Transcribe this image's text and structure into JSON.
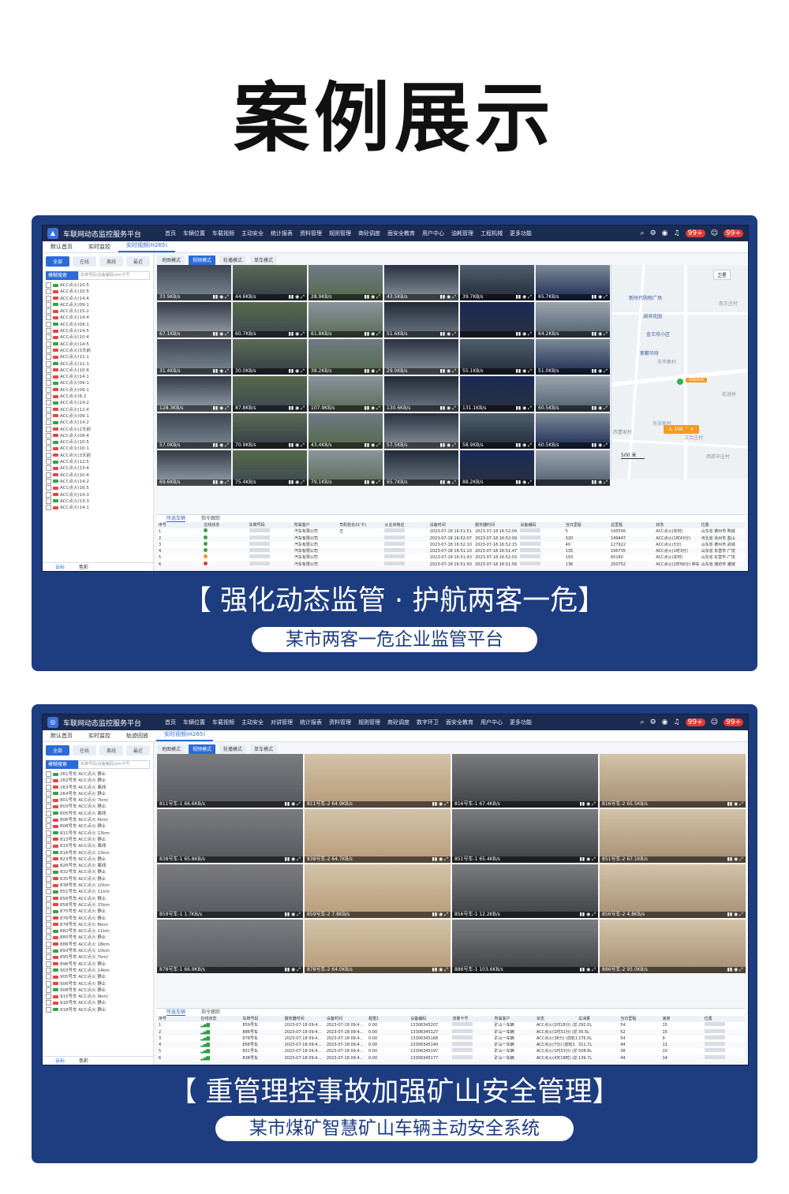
{
  "page": {
    "title": "案例展示"
  },
  "colors": {
    "panel": "#1e3c80",
    "accent": "#2b6bd8",
    "online": "#37a04a",
    "alarm": "#e04848"
  },
  "case1": {
    "caption": "【 强化动态监管 · 护航两客一危】",
    "subtitle": "某市两客一危企业监管平台",
    "app_title": "车联网动态监控服务平台",
    "menu": [
      "首页",
      "车辆位置",
      "车载视频",
      "主动安全",
      "统计报表",
      "资料管理",
      "规则管理",
      "商砼调度",
      "面安全教育",
      "用户中心",
      "油耗管理",
      "工程机械",
      "更多功能"
    ],
    "badges": [
      "99+",
      "99+"
    ],
    "tabs": [
      "默认首页",
      "实时监控",
      "实时视频(H265)"
    ],
    "seg": [
      "全部",
      "在线",
      "离线",
      "最近"
    ],
    "search": {
      "select": "模糊搜索",
      "placeholder": "车牌号码/设备编码/sim卡号"
    },
    "tree": [
      "ACC点火(10:5",
      "ACC点火(10:5",
      "ACC点火(14:4",
      "ACC点火(09:1",
      "ACC点火(15:2",
      "ACC点火(14:4",
      "ACC点火(09:1",
      "ACC点火(14:5",
      "ACC点火(10:4",
      "ACC点火(14:5",
      "ACC点火(3天前",
      "ACC点火(11:1",
      "ACC点火(11:1",
      "ACC点火(10:4",
      "ACC点火(14:1",
      "ACC点火(09:1",
      "ACC点火(09:1",
      "ACC点火(6:2",
      "ACC点火(14:2",
      "ACC点火(12:4",
      "ACC点火(09:1",
      "ACC点火(14:2",
      "ACC点火(2天前",
      "ACC点火(09:4",
      "ACC点火(10:5",
      "ACC点火(10:1",
      "ACC点火(3天前",
      "ACC点火(12:5",
      "ACC点火(13:4",
      "ACC点火(10:4",
      "ACC点火(14:2",
      "ACC点火(16:5",
      "ACC点火(14:3",
      "ACC点火(13:3",
      "ACC点火(14:1"
    ],
    "sidefoot": [
      "云标",
      "色彩"
    ],
    "modes": [
      "地图模式",
      "视频模式",
      "轮播模式",
      "单车模式"
    ],
    "video_rates": [
      "33.9KB/s",
      "44.6KB/s",
      "28.9KB/s",
      "43.5KB/s",
      "39.7KB/s",
      "65.7KB/s",
      "67.1KB/s",
      "60.7KB/s",
      "61.8KB/s",
      "51.6KB/s",
      "",
      "64.2KB/s",
      "31.4KB/s",
      "30.0KB/s",
      "38.2KB/s",
      "29.0KB/s",
      "55.1KB/s",
      "51.0KB/s",
      "128.3KB/s",
      "87.8KB/s",
      "107.9KB/s",
      "130.6KB/s",
      "131.1KB/s",
      "60.5KB/s",
      "57.0KB/s",
      "70.9KB/s",
      "43.4KB/s",
      "57.5KB/s",
      "58.9KB/s",
      "60.5KB/s",
      "69.6KB/s",
      "75.4KB/s",
      "79.1KB/s",
      "65.7KB/s",
      "88.2KB/s",
      ""
    ],
    "map": {
      "type_button": "卫星",
      "scale": "500 米",
      "speed": "25km/h",
      "alarm": "106",
      "pois": [
        "新时代购物广场",
        "湖滨花园",
        "金王府小区",
        "紫都华府",
        "东李集村",
        "南王庄村",
        "前进桥",
        "东张家村",
        "文合庄村",
        "西邵辛庄村",
        "西曹家村"
      ]
    },
    "table_tabs": [
      "所选车辆",
      "指令跟踪"
    ],
    "columns": [
      "序号",
      "在线状态",
      "车牌号码",
      "所属客户",
      "司机姓名(IC卡)",
      "从业资格证",
      "设备时间",
      "服务器时间",
      "设备编码",
      "当日里程",
      "总里程",
      "状态",
      "位置"
    ],
    "rows": [
      {
        "no": "1",
        "status": "g",
        "customer": "汽车有限公司",
        "driver": "王",
        "dev_time": "2023-07-18 16:51:51",
        "srv_time": "2023-07-18 16:52:04",
        "daily": "5",
        "total": "145556",
        "state": "ACC点火(实时)",
        "loc": "山东省 德州市 陶城"
      },
      {
        "no": "2",
        "status": "g",
        "customer": "汽车有限公司",
        "driver": "",
        "dev_time": "2023-07-18 16:52:07",
        "srv_time": "2023-07-18 16:52:09",
        "daily": "320",
        "total": "149447",
        "state": "ACC点火(1时43分)",
        "loc": "河北省 沧州市 盐山"
      },
      {
        "no": "3",
        "status": "g",
        "customer": "汽车有限公司",
        "driver": "",
        "dev_time": "2023-07-18 16:52:10",
        "srv_time": "2023-07-18 16:52:15",
        "daily": "40",
        "total": "127922",
        "state": "ACC点火(3分)",
        "loc": "山东省 德州市 武城"
      },
      {
        "no": "4",
        "status": "g",
        "customer": "汽车有限公司",
        "driver": "",
        "dev_time": "2023-07-18 16:51:10",
        "srv_time": "2023-07-18 16:51:47",
        "daily": "135",
        "total": "195735",
        "state": "ACC点火(1时3分)",
        "loc": "山东省 东营市 广饶"
      },
      {
        "no": "5",
        "status": "o",
        "customer": "汽车有限公司",
        "driver": "",
        "dev_time": "2023-07-18 16:51:43",
        "srv_time": "2023-07-18 16:52:03",
        "daily": "193",
        "total": "65180",
        "state": "ACC点火(实时)",
        "loc": "山东省 东营市 广饶"
      },
      {
        "no": "6",
        "status": "r",
        "customer": "汽车有限公司",
        "driver": "",
        "dev_time": "2023-07-18 16:51:50",
        "srv_time": "2023-07-18 16:51:56",
        "daily": "136",
        "total": "250752",
        "state": "ACC点火(1时56分) 停车(1分)",
        "loc": "山东省 潍坊市 潍城"
      }
    ]
  },
  "case2": {
    "caption": "【 重管理控事故加强矿山安全管理】",
    "subtitle": "某市煤矿智慧矿山车辆主动安全系统",
    "app_title": "车联网动态监控服务平台",
    "menu": [
      "首页",
      "车辆位置",
      "车载视频",
      "主动安全",
      "对讲管理",
      "统计报表",
      "资料管理",
      "规则管理",
      "商砼调度",
      "数字环卫",
      "面安全教育",
      "用户中心",
      "更多功能"
    ],
    "badges": [
      "99+",
      "99+"
    ],
    "tabs": [
      "默认首页",
      "实时监控",
      "轨迹回放",
      "实时视频(H265)"
    ],
    "seg": [
      "全部",
      "在线",
      "离线",
      "最近"
    ],
    "search": {
      "select": "模糊搜索",
      "placeholder": "车牌号码/设备编码/sim卡号"
    },
    "tree": [
      "261号车 ACC点火 静止",
      "262号车 ACC点火 静止",
      "263号车 ACC点火 离线",
      "264号车 ACC点火 静止",
      "801号车 ACC点火 7km/",
      "803号车 ACC点火 静止",
      "805号车 ACC点火 离线",
      "806号车 ACC点火 6km/",
      "808号车 ACC点火 静止",
      "811号车 ACC点火 13km",
      "813号车 ACC点火 静止",
      "815号车 ACC点火 离线",
      "816号车 ACC点火 13km",
      "823号车 ACC点火 静止",
      "826号车 ACC点火 离线",
      "832号车 ACC点火 静止",
      "835号车 ACC点火 静止",
      "838号车 ACC点火 10km",
      "851号车 ACC点火 11km",
      "856号车 ACC点火 静止",
      "858号车 ACC点火 15km",
      "875号车 ACC点火 静止",
      "876号车 ACC点火 静止",
      "878号车 ACC点火 8km/",
      "882号车 ACC点火 11km",
      "885号车 ACC点火 静止",
      "886号车 ACC点火 18km",
      "893号车 ACC点火 10km",
      "895号车 ACC点火 7km/",
      "896号车 ACC点火 静止",
      "903号车 ACC点火 14km",
      "905号车 ACC点火 静止",
      "906号车 ACC点火 静止",
      "908号车 ACC点火 静止",
      "915号车 ACC点火 9km/",
      "916号车 ACC点火 静止",
      "918号车 ACC点火 静止"
    ],
    "sidefoot": [
      "云标",
      "色彩"
    ],
    "modes": [
      "地图模式",
      "视频模式",
      "轮播模式",
      "单车模式"
    ],
    "video_labels": [
      "811号车-1 66.6KB/s",
      "811号车-2 64.9KB/s",
      "816号车-1 67.4KB/s",
      "816号车-2 65.5KB/s",
      "838号车-1 65.8KB/s",
      "838号车-2 64.7KB/s",
      "851号车-1 65.4KB/s",
      "851号车-2 67.1KB/s",
      "859号车-1 1.7KB/s",
      "859号车-2 7.8KB/s",
      "856号车-1 12.2KB/s",
      "856号车-2 4.8KB/s",
      "878号车-1 66.9KB/s",
      "878号车-2 64.0KB/s",
      "886号车-1 103.6KB/s",
      "886号车-2 95.0KB/s"
    ],
    "table_tabs": [
      "所选车辆",
      "指令跟踪"
    ],
    "columns": [
      "序号",
      "在线状态",
      "车牌号码",
      "服务器时间",
      "设备时间",
      "载重1",
      "设备编码",
      "流量卡号",
      "所属客户",
      "状态",
      "总油量",
      "当日里程",
      "速度",
      "位置"
    ],
    "rows": [
      {
        "no": "1",
        "plate": "859号车",
        "srv": "2023-07-18 09:4...",
        "dev": "2023-07-18 09:4...",
        "load": "0.00",
        "code": "13306345207",
        "cust": "矿山一车辆",
        "state": "ACC点火(1时18分) (前轮1 正常...",
        "oil": "292.0L",
        "daily": "54",
        "speed": "15"
      },
      {
        "no": "2",
        "plate": "886号车",
        "srv": "2023-07-18 09:4...",
        "dev": "2023-07-18 09:4...",
        "load": "0.00",
        "code": "13306345127",
        "cust": "矿山一车辆",
        "state": "ACC点火(1时31分) (前轮1 正常...",
        "oil": "35.5L",
        "daily": "52",
        "speed": "15"
      },
      {
        "no": "3",
        "plate": "878号车",
        "srv": "2023-07-18 09:4...",
        "dev": "2023-07-18 09:4...",
        "load": "0.00",
        "code": "13306345168",
        "cust": "矿山一车辆",
        "state": "ACC点火(38分) (前轮1 正常...",
        "oil": "276.0L",
        "daily": "54",
        "speed": "9"
      },
      {
        "no": "4",
        "plate": "856号车",
        "srv": "2023-07-18 09:4...",
        "dev": "2023-07-18 09:4...",
        "load": "0.00",
        "code": "13306345140",
        "cust": "矿山一车辆",
        "state": "ACC点火(7分) (前轮1 正常...",
        "oil": "311.7L",
        "daily": "44",
        "speed": "12"
      },
      {
        "no": "5",
        "plate": "851号车",
        "srv": "2023-07-18 09:4...",
        "dev": "2023-07-18 09:4...",
        "load": "0.00",
        "code": "13306345197",
        "cust": "矿山一车辆",
        "state": "ACC点火(1时33分) (前轮1 正常...",
        "oil": "508.8L",
        "daily": "38",
        "speed": "10"
      },
      {
        "no": "6",
        "plate": "838号车",
        "srv": "2023-07-18 09:4...",
        "dev": "2023-07-18 09:4...",
        "load": "0.00",
        "code": "13306345177",
        "cust": "矿山一车辆",
        "state": "ACC点火(4天18时) (前轮1 正...",
        "oil": "139.7L",
        "daily": "44",
        "speed": "14"
      }
    ]
  }
}
